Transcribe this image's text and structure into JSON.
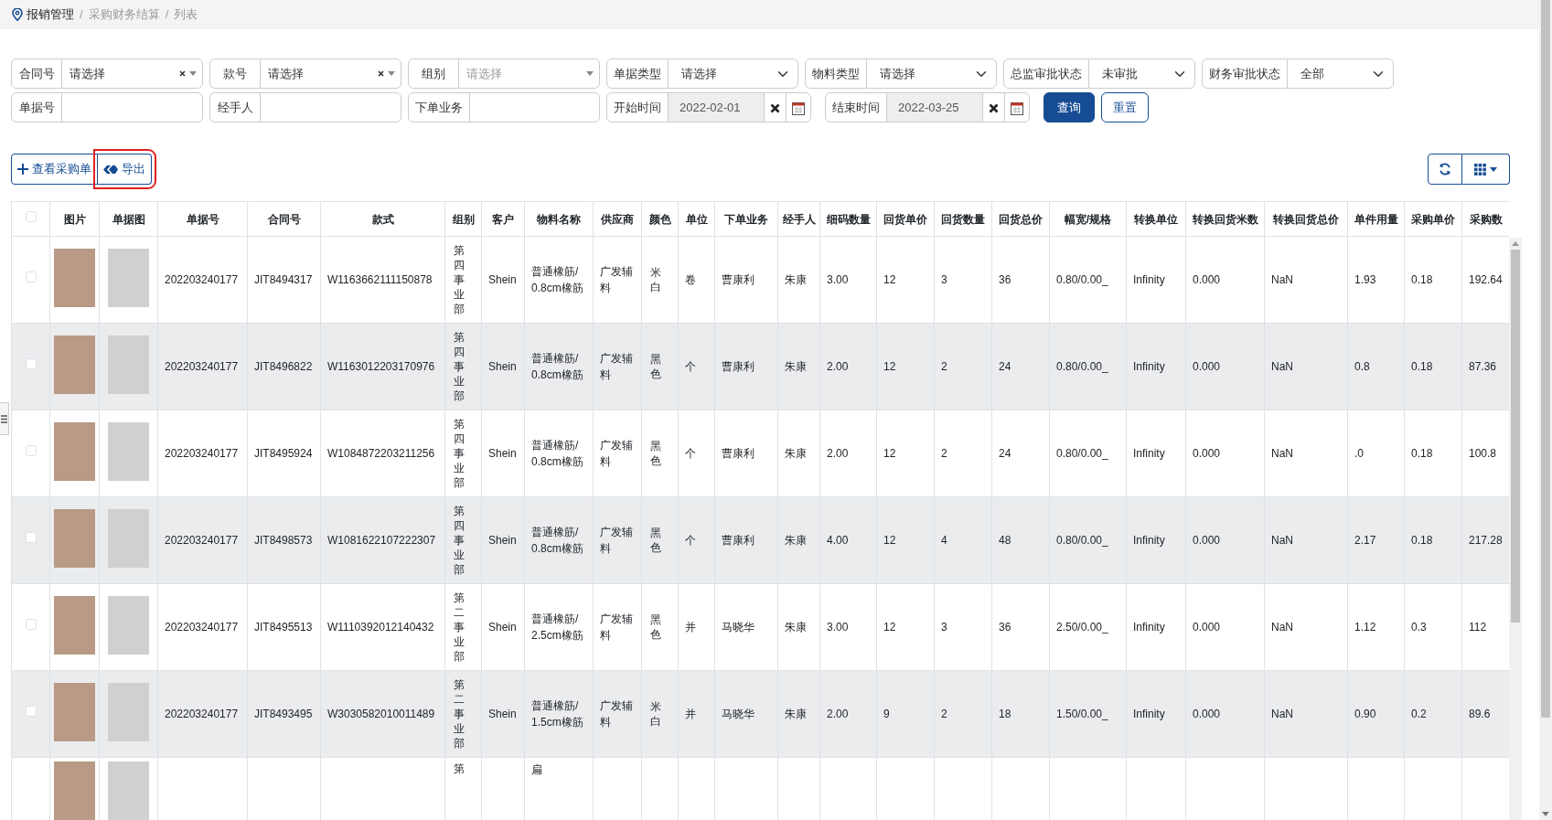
{
  "breadcrumb": [
    {
      "kind": "home",
      "text": "报销管理"
    },
    {
      "kind": "separator",
      "text": "/"
    },
    {
      "kind": "link",
      "text": "采购财务结算"
    },
    {
      "kind": "separator",
      "text": "/"
    },
    {
      "kind": "current",
      "text": "列表"
    }
  ],
  "filters": [
    [
      {
        "kind": "combo",
        "label": "合同号",
        "value": "请选择",
        "clearable": true
      },
      {
        "kind": "combo",
        "label": "款号",
        "value": "请选择",
        "clearable": true
      },
      {
        "kind": "combo",
        "label": "组别",
        "placeholder": "请选择",
        "clearable": false
      },
      {
        "kind": "select",
        "label": "单据类型",
        "value": "请选择"
      },
      {
        "kind": "select",
        "label": "物料类型",
        "value": "请选择"
      },
      {
        "kind": "select",
        "label": "总监审批状态",
        "value": "未审批"
      },
      {
        "kind": "select",
        "label": "财务审批状态",
        "value": "全部"
      }
    ],
    [
      {
        "kind": "text",
        "label": "单据号"
      },
      {
        "kind": "text",
        "label": "经手人"
      },
      {
        "kind": "text",
        "label": "下单业务"
      },
      {
        "kind": "date",
        "label": "开始时间",
        "value": "2022-02-01"
      },
      {
        "kind": "date",
        "label": "结束时间",
        "value": "2022-03-25"
      },
      {
        "kind": "primary",
        "label": "查询"
      },
      {
        "kind": "outline",
        "label": "重置"
      }
    ]
  ],
  "toolbar": [
    {
      "kind": "add",
      "label": "查看采购单",
      "highlighted": false
    },
    {
      "kind": "export",
      "label": "导出",
      "highlighted": true
    }
  ],
  "table": {
    "select_all": {
      "checked": false
    },
    "columns": [
      "图片",
      "单据图",
      "单据号",
      "合同号",
      "款式",
      "组别",
      "客户",
      "物料名称",
      "供应商",
      "颜色",
      "单位",
      "下单业务",
      "经手人",
      "细码数量",
      "回货单价",
      "回货数量",
      "回货总价",
      "幅宽/规格",
      "转换单位",
      "转换回货米数",
      "转换回货总价",
      "单件用量",
      "采购单价",
      "采购数"
    ],
    "rows": [
      {
        "kind": "full",
        "checked": false,
        "cells": [
          "202203240177",
          "JIT8494317",
          "W1163662111150878",
          "第四事业部",
          "Shein",
          "普通橡筋/0.8cm橡筋",
          "广发辅料",
          "米白",
          "卷",
          "曹康利",
          "朱康",
          "3.00",
          "12",
          "3",
          "36",
          "0.80/0.00_",
          "Infinity",
          "0.000",
          "NaN",
          "1.93",
          "0.18",
          "192.64"
        ]
      },
      {
        "kind": "full",
        "checked": false,
        "cells": [
          "202203240177",
          "JIT8496822",
          "W1163012203170976",
          "第四事业部",
          "Shein",
          "普通橡筋/0.8cm橡筋",
          "广发辅料",
          "黑色",
          "个",
          "曹康利",
          "朱康",
          "2.00",
          "12",
          "2",
          "24",
          "0.80/0.00_",
          "Infinity",
          "0.000",
          "NaN",
          "0.8",
          "0.18",
          "87.36"
        ]
      },
      {
        "kind": "full",
        "checked": false,
        "cells": [
          "202203240177",
          "JIT8495924",
          "W1084872203211256",
          "第四事业部",
          "Shein",
          "普通橡筋/0.8cm橡筋",
          "广发辅料",
          "黑色",
          "个",
          "曹康利",
          "朱康",
          "2.00",
          "12",
          "2",
          "24",
          "0.80/0.00_",
          "Infinity",
          "0.000",
          "NaN",
          ".0",
          "0.18",
          "100.8"
        ]
      },
      {
        "kind": "full",
        "checked": false,
        "cells": [
          "202203240177",
          "JIT8498573",
          "W1081622107222307",
          "第四事业部",
          "Shein",
          "普通橡筋/0.8cm橡筋",
          "广发辅料",
          "黑色",
          "个",
          "曹康利",
          "朱康",
          "4.00",
          "12",
          "4",
          "48",
          "0.80/0.00_",
          "Infinity",
          "0.000",
          "NaN",
          "2.17",
          "0.18",
          "217.28"
        ]
      },
      {
        "kind": "full",
        "checked": false,
        "cells": [
          "202203240177",
          "JIT8495513",
          "W1110392012140432",
          "第二事业部",
          "Shein",
          "普通橡筋/2.5cm橡筋",
          "广发辅料",
          "黑色",
          "并",
          "马晓华",
          "朱康",
          "3.00",
          "12",
          "3",
          "36",
          "2.50/0.00_",
          "Infinity",
          "0.000",
          "NaN",
          "1.12",
          "0.3",
          "112"
        ]
      },
      {
        "kind": "full",
        "checked": false,
        "cells": [
          "202203240177",
          "JIT8493495",
          "W3030582010011489",
          "第二事业部",
          "Shein",
          "普通橡筋/1.5cm橡筋",
          "广发辅料",
          "米白",
          "并",
          "马晓华",
          "朱康",
          "2.00",
          "9",
          "2",
          "18",
          "1.50/0.00_",
          "Infinity",
          "0.000",
          "NaN",
          "0.90",
          "0.2",
          "89.6"
        ]
      },
      {
        "kind": "partial",
        "group": "第",
        "material": "扁"
      }
    ]
  }
}
